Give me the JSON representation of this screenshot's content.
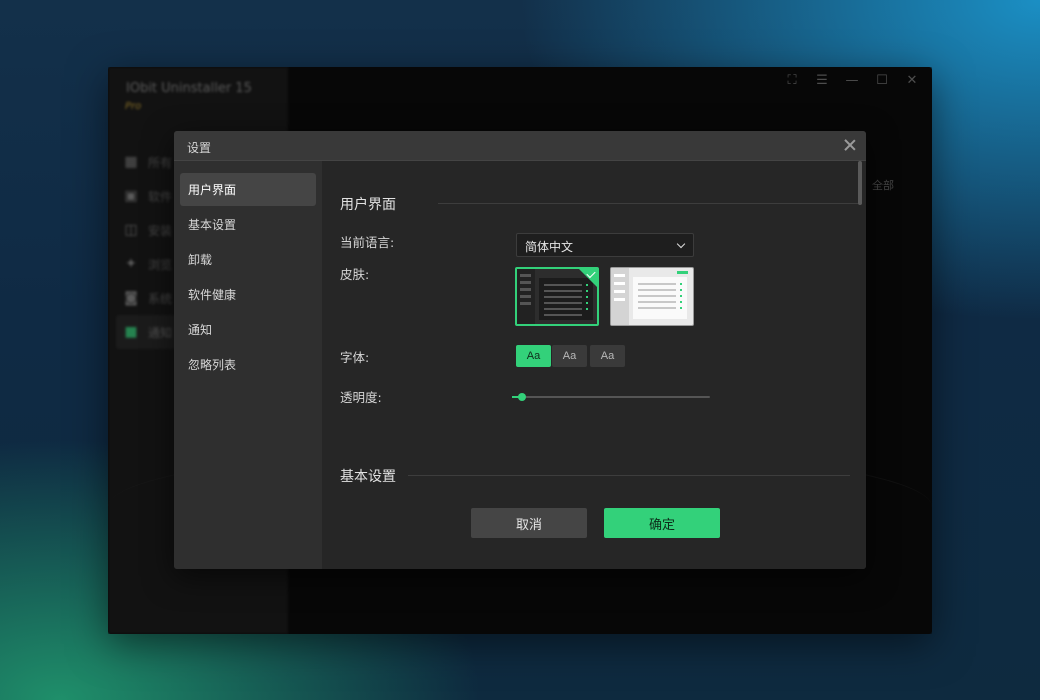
{
  "background_app": {
    "title": "IObit Uninstaller 15",
    "edition": "Pro",
    "nav_items": [
      {
        "icon": "grid-icon",
        "label": "所有"
      },
      {
        "icon": "software-icon",
        "label": "软件"
      },
      {
        "icon": "install-icon",
        "label": "安装"
      },
      {
        "icon": "browser-icon",
        "label": "浏览"
      },
      {
        "icon": "system-icon",
        "label": "系统"
      },
      {
        "icon": "chat-icon",
        "label": "通知"
      }
    ],
    "top_icons": [
      "gift-icon",
      "menu-icon",
      "minimize-icon",
      "maximize-icon",
      "close-icon"
    ],
    "right_text": "全部"
  },
  "dialog": {
    "title": "设置",
    "nav": [
      {
        "label": "用户界面",
        "active": true
      },
      {
        "label": "基本设置",
        "active": false
      },
      {
        "label": "卸载",
        "active": false
      },
      {
        "label": "软件健康",
        "active": false
      },
      {
        "label": "通知",
        "active": false
      },
      {
        "label": "忽略列表",
        "active": false
      }
    ],
    "section_ui": "用户界面",
    "language_label": "当前语言:",
    "language_value": "简体中文",
    "skin_label": "皮肤:",
    "skins": [
      {
        "name": "dark",
        "selected": true
      },
      {
        "name": "light",
        "selected": false
      }
    ],
    "font_label": "字体:",
    "font_options": [
      {
        "label": "Aa",
        "active": true
      },
      {
        "label": "Aa",
        "active": false
      },
      {
        "label": "Aa",
        "active": false
      }
    ],
    "opacity_label": "透明度:",
    "opacity_value": 0.05,
    "section_basic": "基本设置",
    "cancel_label": "取消",
    "ok_label": "确定"
  },
  "colors": {
    "accent": "#33d17a",
    "dialog_bg": "#262626",
    "nav_bg": "#2f2f2f"
  }
}
